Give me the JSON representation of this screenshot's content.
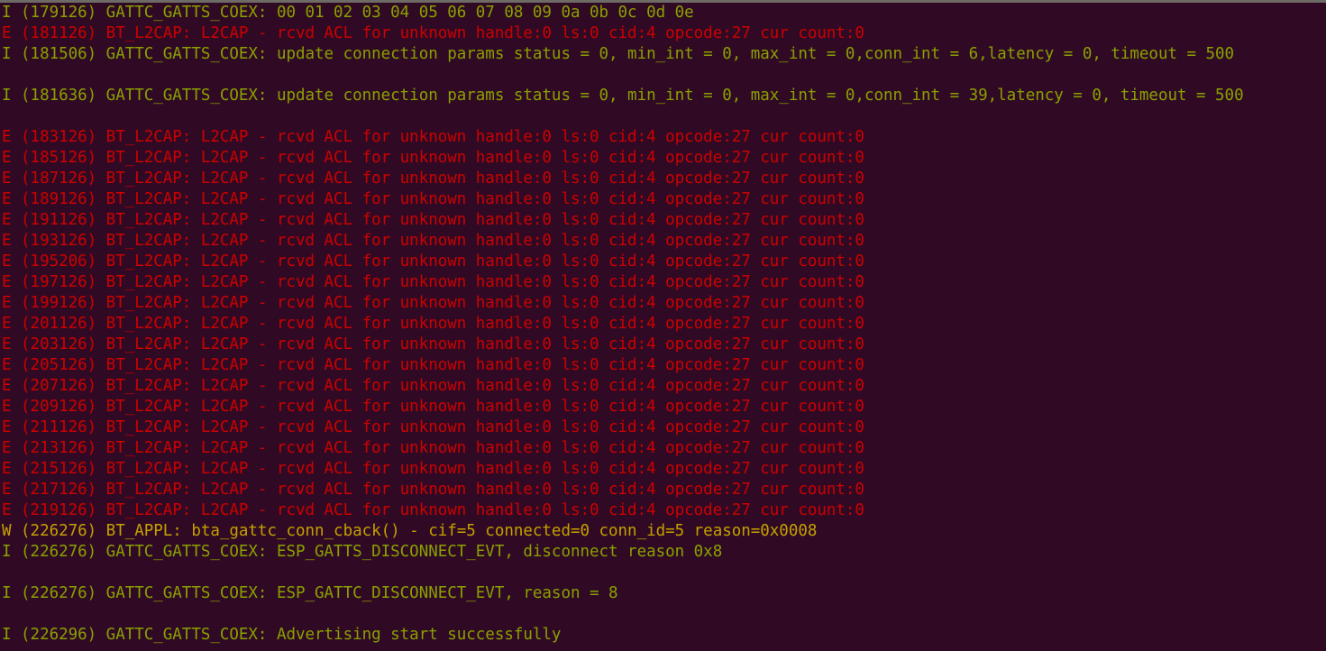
{
  "terminal": {
    "app_kind": "serial-monitor-terminal",
    "background_color": "#300a24",
    "colors": {
      "info": "#8aa000",
      "error": "#cc0000",
      "warning": "#c4a000",
      "top_strip": "#6e6a65"
    },
    "log_lines": [
      {
        "level": "I",
        "text": "I (179126) GATTC_GATTS_COEX: 00 01 02 03 04 05 06 07 08 09 0a 0b 0c 0d 0e"
      },
      {
        "level": "E",
        "text": "E (181126) BT_L2CAP: L2CAP - rcvd ACL for unknown handle:0 ls:0 cid:4 opcode:27 cur count:0"
      },
      {
        "level": "I",
        "text": "I (181506) GATTC_GATTS_COEX: update connection params status = 0, min_int = 0, max_int = 0,conn_int = 6,latency = 0, timeout = 500"
      },
      {
        "level": "blank",
        "text": ""
      },
      {
        "level": "I",
        "text": "I (181636) GATTC_GATTS_COEX: update connection params status = 0, min_int = 0, max_int = 0,conn_int = 39,latency = 0, timeout = 500"
      },
      {
        "level": "blank",
        "text": ""
      },
      {
        "level": "E",
        "text": "E (183126) BT_L2CAP: L2CAP - rcvd ACL for unknown handle:0 ls:0 cid:4 opcode:27 cur count:0"
      },
      {
        "level": "E",
        "text": "E (185126) BT_L2CAP: L2CAP - rcvd ACL for unknown handle:0 ls:0 cid:4 opcode:27 cur count:0"
      },
      {
        "level": "E",
        "text": "E (187126) BT_L2CAP: L2CAP - rcvd ACL for unknown handle:0 ls:0 cid:4 opcode:27 cur count:0"
      },
      {
        "level": "E",
        "text": "E (189126) BT_L2CAP: L2CAP - rcvd ACL for unknown handle:0 ls:0 cid:4 opcode:27 cur count:0"
      },
      {
        "level": "E",
        "text": "E (191126) BT_L2CAP: L2CAP - rcvd ACL for unknown handle:0 ls:0 cid:4 opcode:27 cur count:0"
      },
      {
        "level": "E",
        "text": "E (193126) BT_L2CAP: L2CAP - rcvd ACL for unknown handle:0 ls:0 cid:4 opcode:27 cur count:0"
      },
      {
        "level": "E",
        "text": "E (195206) BT_L2CAP: L2CAP - rcvd ACL for unknown handle:0 ls:0 cid:4 opcode:27 cur count:0"
      },
      {
        "level": "E",
        "text": "E (197126) BT_L2CAP: L2CAP - rcvd ACL for unknown handle:0 ls:0 cid:4 opcode:27 cur count:0"
      },
      {
        "level": "E",
        "text": "E (199126) BT_L2CAP: L2CAP - rcvd ACL for unknown handle:0 ls:0 cid:4 opcode:27 cur count:0"
      },
      {
        "level": "E",
        "text": "E (201126) BT_L2CAP: L2CAP - rcvd ACL for unknown handle:0 ls:0 cid:4 opcode:27 cur count:0"
      },
      {
        "level": "E",
        "text": "E (203126) BT_L2CAP: L2CAP - rcvd ACL for unknown handle:0 ls:0 cid:4 opcode:27 cur count:0"
      },
      {
        "level": "E",
        "text": "E (205126) BT_L2CAP: L2CAP - rcvd ACL for unknown handle:0 ls:0 cid:4 opcode:27 cur count:0"
      },
      {
        "level": "E",
        "text": "E (207126) BT_L2CAP: L2CAP - rcvd ACL for unknown handle:0 ls:0 cid:4 opcode:27 cur count:0"
      },
      {
        "level": "E",
        "text": "E (209126) BT_L2CAP: L2CAP - rcvd ACL for unknown handle:0 ls:0 cid:4 opcode:27 cur count:0"
      },
      {
        "level": "E",
        "text": "E (211126) BT_L2CAP: L2CAP - rcvd ACL for unknown handle:0 ls:0 cid:4 opcode:27 cur count:0"
      },
      {
        "level": "E",
        "text": "E (213126) BT_L2CAP: L2CAP - rcvd ACL for unknown handle:0 ls:0 cid:4 opcode:27 cur count:0"
      },
      {
        "level": "E",
        "text": "E (215126) BT_L2CAP: L2CAP - rcvd ACL for unknown handle:0 ls:0 cid:4 opcode:27 cur count:0"
      },
      {
        "level": "E",
        "text": "E (217126) BT_L2CAP: L2CAP - rcvd ACL for unknown handle:0 ls:0 cid:4 opcode:27 cur count:0"
      },
      {
        "level": "E",
        "text": "E (219126) BT_L2CAP: L2CAP - rcvd ACL for unknown handle:0 ls:0 cid:4 opcode:27 cur count:0"
      },
      {
        "level": "W",
        "text": "W (226276) BT_APPL: bta_gattc_conn_cback() - cif=5 connected=0 conn_id=5 reason=0x0008"
      },
      {
        "level": "I",
        "text": "I (226276) GATTC_GATTS_COEX: ESP_GATTS_DISCONNECT_EVT, disconnect reason 0x8"
      },
      {
        "level": "blank",
        "text": ""
      },
      {
        "level": "I",
        "text": "I (226276) GATTC_GATTS_COEX: ESP_GATTC_DISCONNECT_EVT, reason = 8"
      },
      {
        "level": "blank",
        "text": ""
      },
      {
        "level": "I",
        "text": "I (226296) GATTC_GATTS_COEX: Advertising start successfully"
      }
    ]
  }
}
